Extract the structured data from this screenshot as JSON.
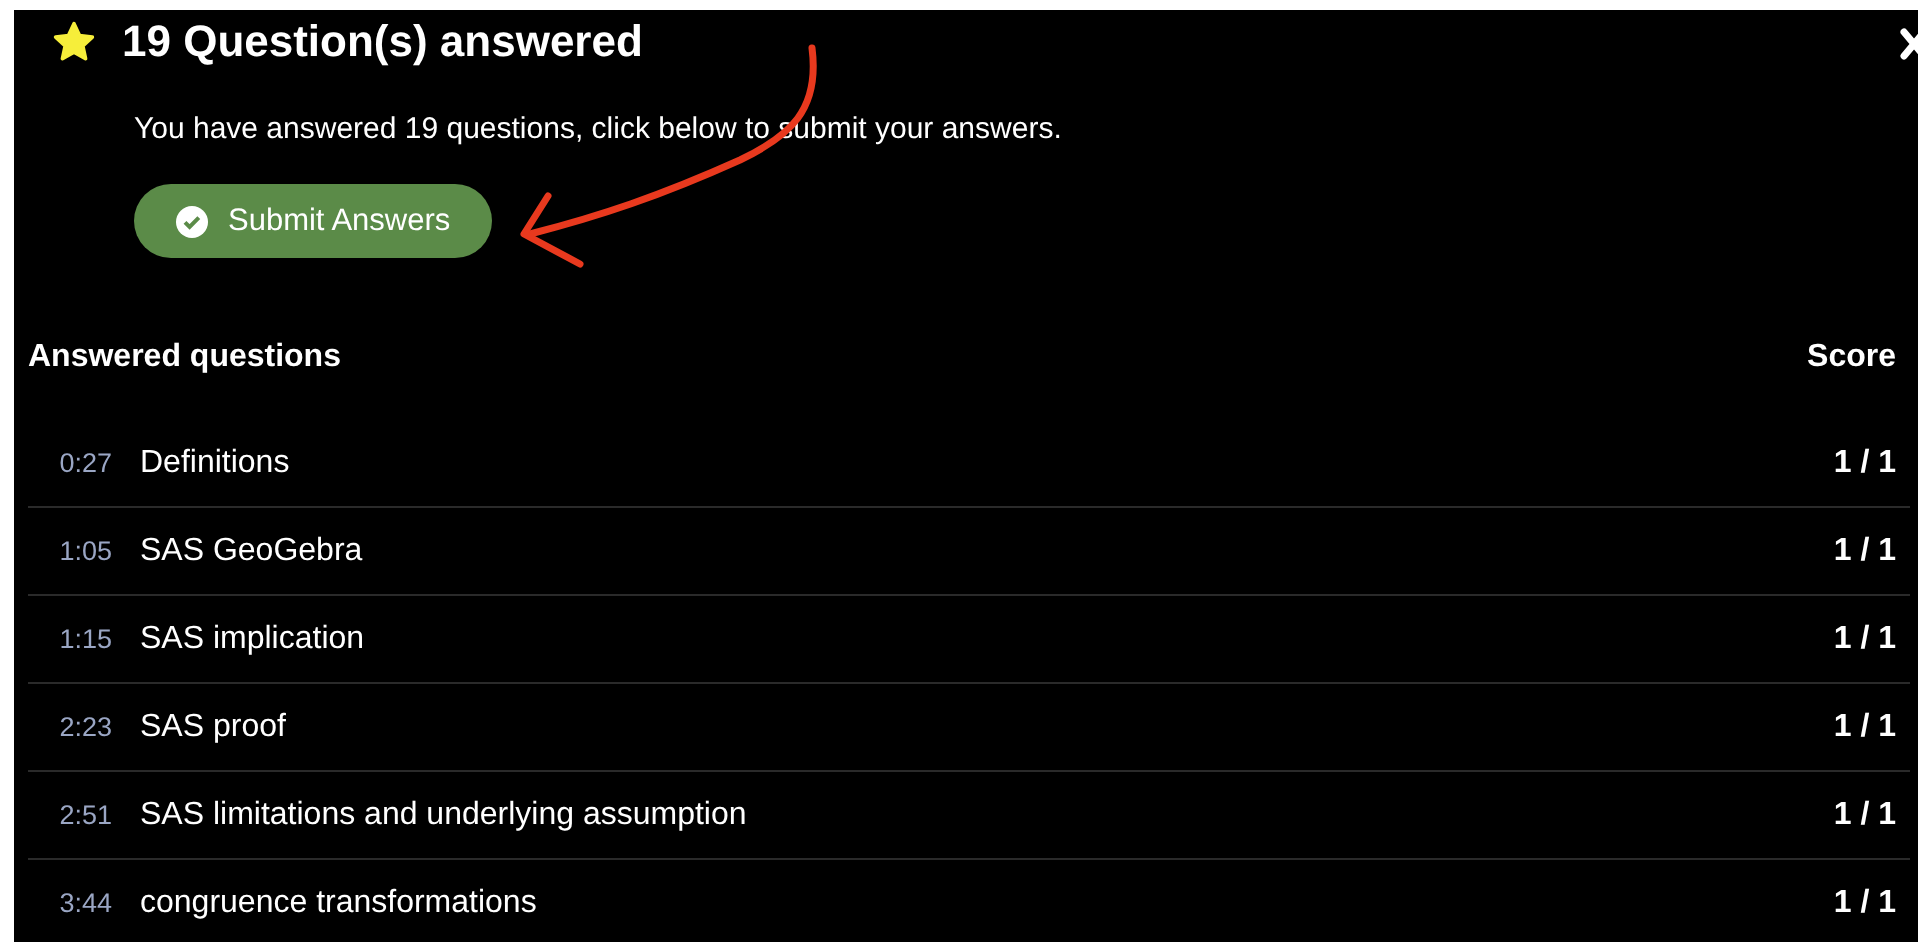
{
  "dialog": {
    "title": "19 Question(s) answered",
    "message": "You have answered 19 questions, click below to submit your answers.",
    "submit_button": "Submit Answers"
  },
  "table": {
    "columns": [
      "Answered questions",
      "Score"
    ],
    "rows": [
      {
        "time": "0:27",
        "name": "Definitions",
        "score": "1 / 1"
      },
      {
        "time": "1:05",
        "name": "SAS GeoGebra",
        "score": "1 / 1"
      },
      {
        "time": "1:15",
        "name": "SAS implication",
        "score": "1 / 1"
      },
      {
        "time": "2:23",
        "name": "SAS proof",
        "score": "1 / 1"
      },
      {
        "time": "2:51",
        "name": "SAS limitations and underlying assumption",
        "score": "1 / 1"
      },
      {
        "time": "3:44",
        "name": "congruence transformations",
        "score": "1 / 1"
      }
    ]
  }
}
